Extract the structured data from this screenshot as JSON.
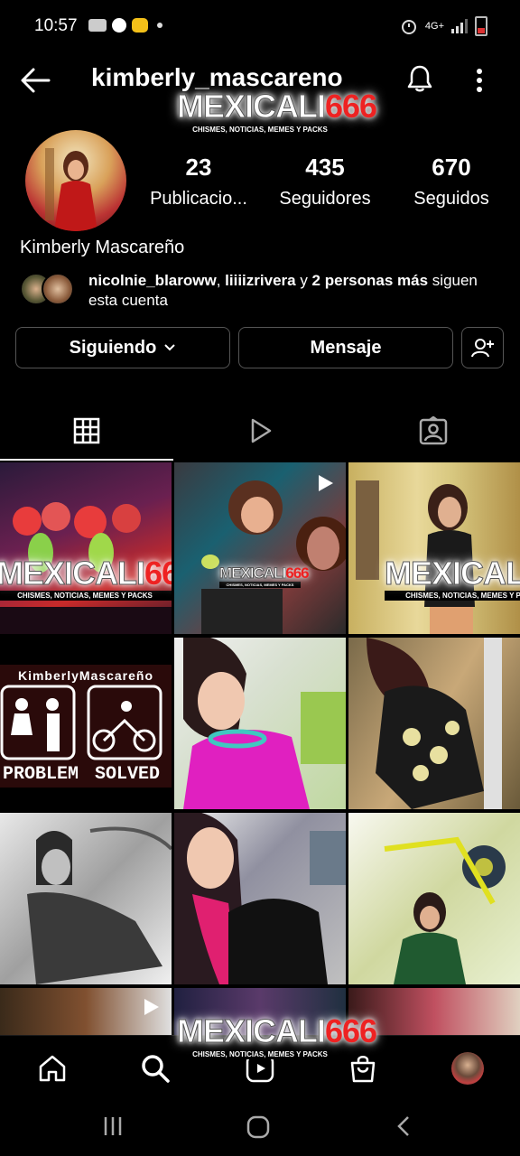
{
  "status_bar": {
    "time": "10:57",
    "network": "4G+"
  },
  "header": {
    "username": "kimberly_mascareno"
  },
  "watermark": {
    "brand_white": "MEXICALI",
    "brand_red": "666",
    "tagline": "CHISMES, NOTICIAS, MEMES Y PACKS"
  },
  "profile": {
    "stats": [
      {
        "value": "23",
        "label": "Publicacio..."
      },
      {
        "value": "435",
        "label": "Seguidores"
      },
      {
        "value": "670",
        "label": "Seguidos"
      }
    ],
    "full_name": "Kimberly Mascareño",
    "followed_by": {
      "user1": "nicolnie_blaroww",
      "sep": ", ",
      "user2": "liiiizrivera",
      "connector": " y ",
      "others": "2 personas más",
      "suffix": " siguen esta cuenta"
    }
  },
  "actions": {
    "following_label": "Siguiendo",
    "message_label": "Mensaje"
  },
  "grid": {
    "post4": {
      "name": "KimberlyMascareño",
      "left": "PROBLEM",
      "right": "SOLVED"
    }
  },
  "colors": {
    "background": "#000000",
    "accent_red": "#e22222",
    "border": "#555555"
  },
  "icons": [
    "back-arrow-icon",
    "bell-icon",
    "more-vertical-icon",
    "chevron-down-icon",
    "add-person-icon",
    "grid-icon",
    "reels-icon",
    "tagged-icon",
    "play-icon",
    "home-icon",
    "search-icon",
    "reels-nav-icon",
    "shop-icon",
    "profile-avatar-icon"
  ]
}
